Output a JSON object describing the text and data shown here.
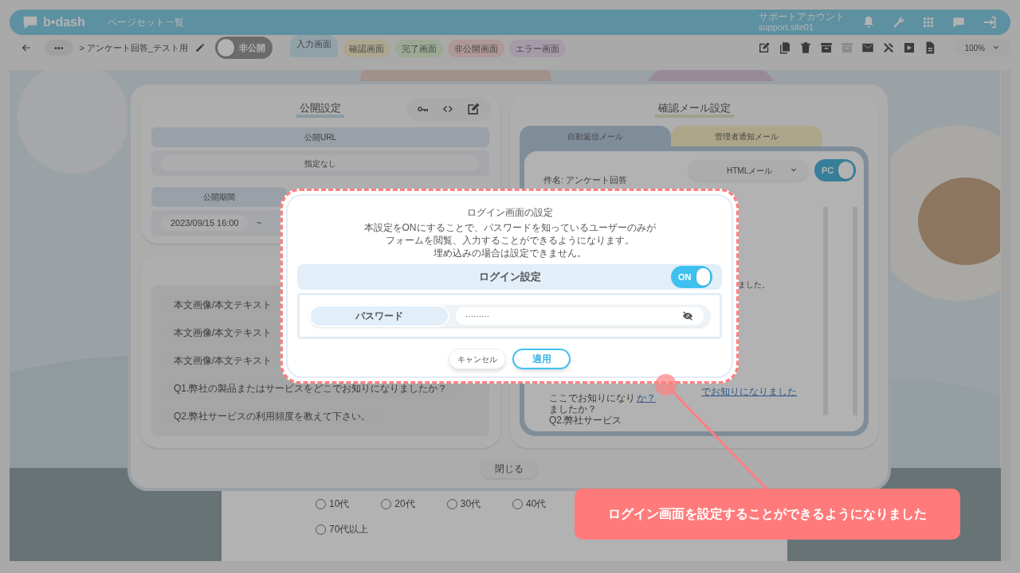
{
  "header": {
    "logo": "b•dash",
    "title": "ページセット一覧",
    "account_name": "サポートアカウント",
    "account_id": "support.site01"
  },
  "toolbar": {
    "breadcrumb_more": "•••",
    "breadcrumb": "> アンケート回答_テスト用",
    "publish_toggle": {
      "label": "非公開",
      "on": false
    },
    "screen_tabs": [
      {
        "label": "入力画面",
        "selected": true,
        "color": "#91a1a8"
      },
      {
        "label": "確認画面",
        "selected": false,
        "color": "#aca68f"
      },
      {
        "label": "完了画面",
        "selected": false,
        "color": "#9ba893"
      },
      {
        "label": "非公開画面",
        "selected": false,
        "color": "#ae9797"
      },
      {
        "label": "エラー画面",
        "selected": false,
        "color": "#a59aa8"
      }
    ],
    "zoom": "100%"
  },
  "form": {
    "options": [
      "10代",
      "20代",
      "30代",
      "40代"
    ],
    "last_option": "70代以上"
  },
  "settings_modal": {
    "public": {
      "title": "公開設定",
      "url_label": "公開URL",
      "url_value": "指定なし",
      "period_label": "公開期間",
      "period_start": "2023/09/15 16:00",
      "period_separator": "~"
    },
    "content_items": [
      "本文画像/本文テキスト",
      "本文画像/本文テキスト",
      "本文画像/本文テキスト",
      "Q1.弊社の製品またはサービスをどこでお知りになりましたか？",
      "Q2.弊社サービスの利用頻度を教えて下さい。"
    ],
    "mail": {
      "title": "確認メール設定",
      "tabs": [
        {
          "label": "自動返信メール",
          "selected": true
        },
        {
          "label": "管理者通知メール",
          "selected": false
        }
      ],
      "format": "HTMLメール",
      "device_toggle": {
        "label": "PC",
        "on": true
      },
      "subject": "件名: アンケート回答",
      "preview_tail": "ました。",
      "link_tail": "でお知りになりました",
      "question_lines": [
        "ここでお知りになり",
        "ましたか？",
        "Q2.弊社サービス"
      ],
      "link_mark": "か？"
    },
    "close": "閉じる"
  },
  "login_dialog": {
    "title": "ログイン画面の設定",
    "description": [
      "本設定をONにすることで、パスワードを知っているユーザーのみが",
      "フォームを閲覧、入力することができるようになります。",
      "埋め込みの場合は設定できません。"
    ],
    "login_setting": {
      "label": "ログイン設定",
      "toggle_label": "ON",
      "on": true
    },
    "password": {
      "label": "パスワード",
      "value": "·········"
    },
    "buttons": {
      "cancel": "キャンセル",
      "apply": "適用"
    }
  },
  "annotation": {
    "text": "ログイン画面を設定することができるようになりました"
  }
}
